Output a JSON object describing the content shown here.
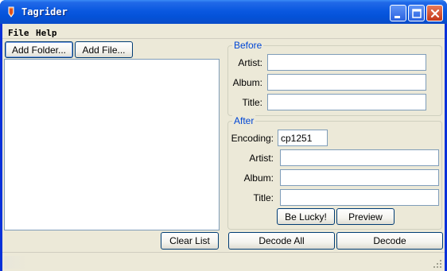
{
  "window": {
    "title": "Tagrider",
    "icon": "pencil-icon"
  },
  "menu": {
    "items": [
      {
        "label": "File"
      },
      {
        "label": "Help"
      }
    ]
  },
  "toolbar": {
    "add_folder_label": "Add Folder...",
    "add_file_label": "Add File..."
  },
  "filelist": {
    "items": []
  },
  "clear_list_label": "Clear List",
  "before": {
    "title": "Before",
    "artist_label": "Artist:",
    "artist_value": "",
    "album_label": "Album:",
    "album_value": "",
    "title_label": "Title:",
    "title_value": ""
  },
  "after": {
    "title": "After",
    "encoding_label": "Encoding:",
    "encoding_value": "cp1251",
    "artist_label": "Artist:",
    "artist_value": "",
    "album_label": "Album:",
    "album_value": "",
    "title_label": "Title:",
    "title_value": "",
    "be_lucky_label": "Be Lucky!",
    "preview_label": "Preview"
  },
  "actions": {
    "decode_all_label": "Decode All",
    "decode_label": "Decode"
  },
  "colors": {
    "titlebar": "#0a58e0",
    "client_bg": "#ece9d8",
    "group_title": "#0046d5",
    "field_border": "#7f9db9"
  }
}
